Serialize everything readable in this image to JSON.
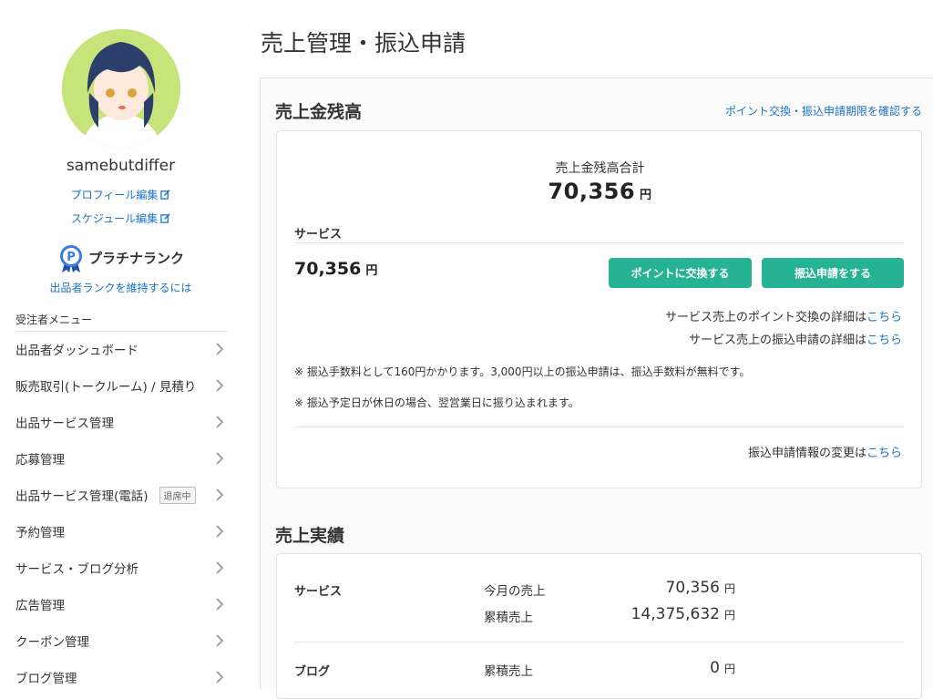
{
  "sidebar": {
    "username": "samebutdiffer",
    "profile_edit": "プロフィール編集",
    "schedule_edit": "スケジュール編集",
    "rank_name": "プラチナランク",
    "rank_link": "出品者ランクを維持するには",
    "menu_heading": "受注者メニュー",
    "menu": [
      {
        "label": "出品者ダッシュボード"
      },
      {
        "label": "販売取引(トークルーム) / 見積り"
      },
      {
        "label": "出品サービス管理"
      },
      {
        "label": "応募管理"
      },
      {
        "label": "出品サービス管理(電話)",
        "badge": "退席中"
      },
      {
        "label": "予約管理"
      },
      {
        "label": "サービス・ブログ分析"
      },
      {
        "label": "広告管理"
      },
      {
        "label": "クーポン管理"
      },
      {
        "label": "ブログ管理"
      }
    ]
  },
  "main": {
    "page_title": "売上管理・振込申請",
    "balance": {
      "title": "売上金残高",
      "top_link": "ポイント交換・振込申請期限を確認する",
      "total_label": "売上金残高合計",
      "total_value": "70,356",
      "yen": "円",
      "service_label": "サービス",
      "service_value": "70,356",
      "btn_point": "ポイントに交換する",
      "btn_transfer": "振込申請をする",
      "detail1_text": "サービス売上のポイント交換の詳細は",
      "detail2_text": "サービス売上の振込申請の詳細は",
      "detail_link": "こちら",
      "note1": "※ 振込手数料として160円かかります。3,000円以上の振込申請は、振込手数料が無料です。",
      "note2": "※ 振込予定日が休日の場合、翌営業日に振り込まれます。",
      "change_text": "振込申請情報の変更は"
    },
    "results": {
      "title": "売上実績",
      "rows": [
        {
          "category": "サービス",
          "label": "今月の売上",
          "value": "70,356"
        },
        {
          "category": "",
          "label": "累積売上",
          "value": "14,375,632"
        },
        {
          "category": "ブログ",
          "label": "累積売上",
          "value": "0"
        }
      ]
    }
  },
  "colors": {
    "accent": "#25b393",
    "link": "#1a73c7",
    "avatar_bg": "#c6e47a"
  }
}
